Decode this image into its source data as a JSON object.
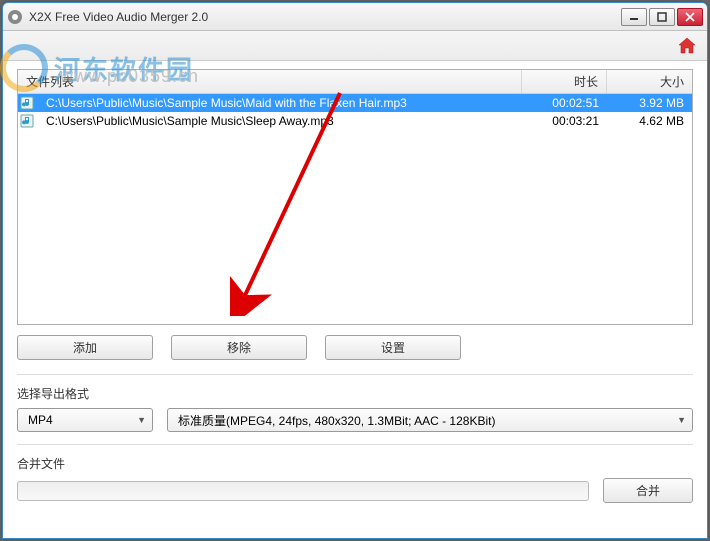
{
  "window": {
    "title": "X2X Free Video Audio Merger 2.0"
  },
  "list": {
    "headers": {
      "file": "文件列表",
      "duration": "时长",
      "size": "大小"
    },
    "rows": [
      {
        "path": "C:\\Users\\Public\\Music\\Sample Music\\Maid with the Flaxen Hair.mp3",
        "duration": "00:02:51",
        "size": "3.92 MB",
        "selected": true
      },
      {
        "path": "C:\\Users\\Public\\Music\\Sample Music\\Sleep Away.mp3",
        "duration": "00:03:21",
        "size": "4.62 MB",
        "selected": false
      }
    ]
  },
  "buttons": {
    "add": "添加",
    "remove": "移除",
    "settings": "设置",
    "merge": "合并"
  },
  "labels": {
    "output_format": "选择导出格式",
    "merge_file": "合并文件"
  },
  "format": {
    "container": "MP4",
    "quality": "标准质量(MPEG4, 24fps, 480x320, 1.3MBit;  AAC - 128KBit)"
  },
  "watermark": {
    "text": "河东软件园",
    "url": "www.pc0359.cn"
  }
}
